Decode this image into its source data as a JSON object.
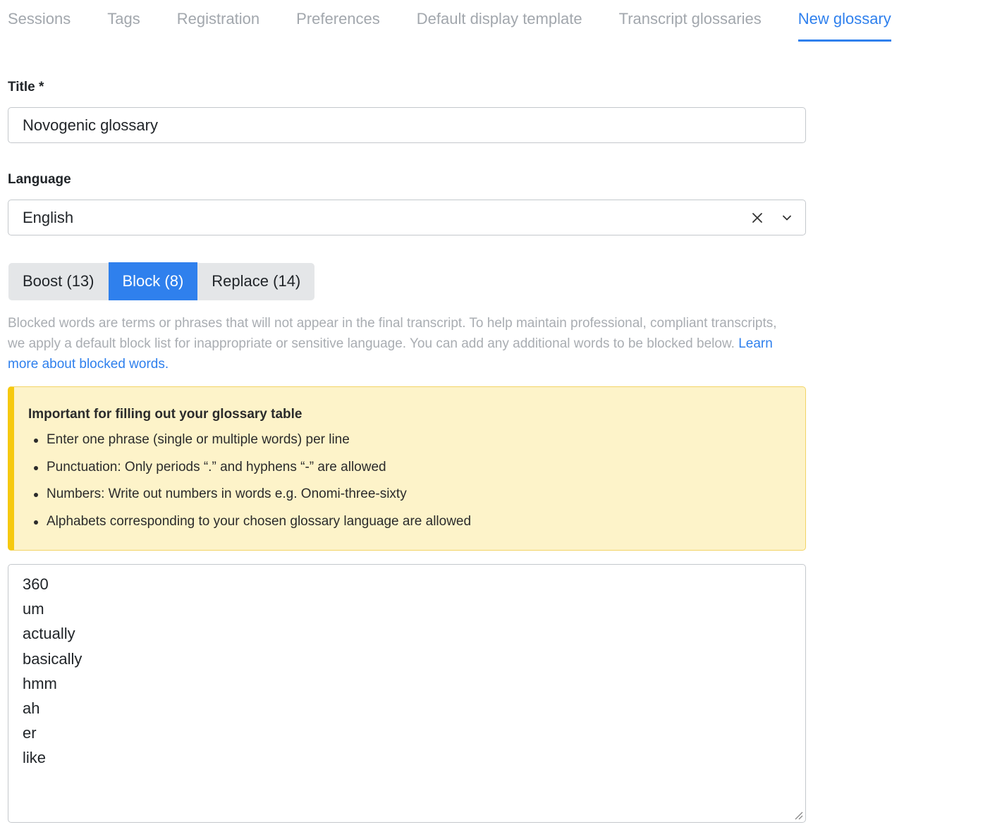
{
  "nav": {
    "tabs": [
      {
        "label": "Sessions"
      },
      {
        "label": "Tags"
      },
      {
        "label": "Registration"
      },
      {
        "label": "Preferences"
      },
      {
        "label": "Default display template"
      },
      {
        "label": "Transcript glossaries"
      },
      {
        "label": "New glossary",
        "active": true
      }
    ]
  },
  "form": {
    "title_label": "Title *",
    "title_value": "Novogenic glossary",
    "language_label": "Language",
    "language_value": "English",
    "icons": {
      "clear": "close-icon",
      "dropdown": "chevron-down-icon"
    }
  },
  "segments": [
    {
      "label": "Boost (13)"
    },
    {
      "label": "Block (8)",
      "active": true
    },
    {
      "label": "Replace (14)"
    }
  ],
  "help": {
    "text": "Blocked words are terms or phrases that will not appear in the final transcript. To help maintain professional, compliant transcripts, we apply a default block list for inappropriate or sensitive language. You can add any additional words to be blocked below. ",
    "link": "Learn more about blocked words."
  },
  "alert": {
    "title": "Important for filling out your glossary table",
    "items": [
      "Enter one phrase (single or multiple words) per line",
      "Punctuation: Only periods “.” and hyphens “-” are allowed",
      "Numbers: Write out numbers in words e.g. Onomi-three-sixty",
      "Alphabets corresponding to your chosen glossary language are allowed"
    ]
  },
  "blocked_words": [
    "360",
    "um",
    "actually",
    "basically",
    "hmm",
    "ah",
    "er",
    "like"
  ],
  "colors": {
    "accent": "#2f80ed",
    "alert_bg": "#fdf3c9",
    "alert_bar": "#f6c90e"
  }
}
